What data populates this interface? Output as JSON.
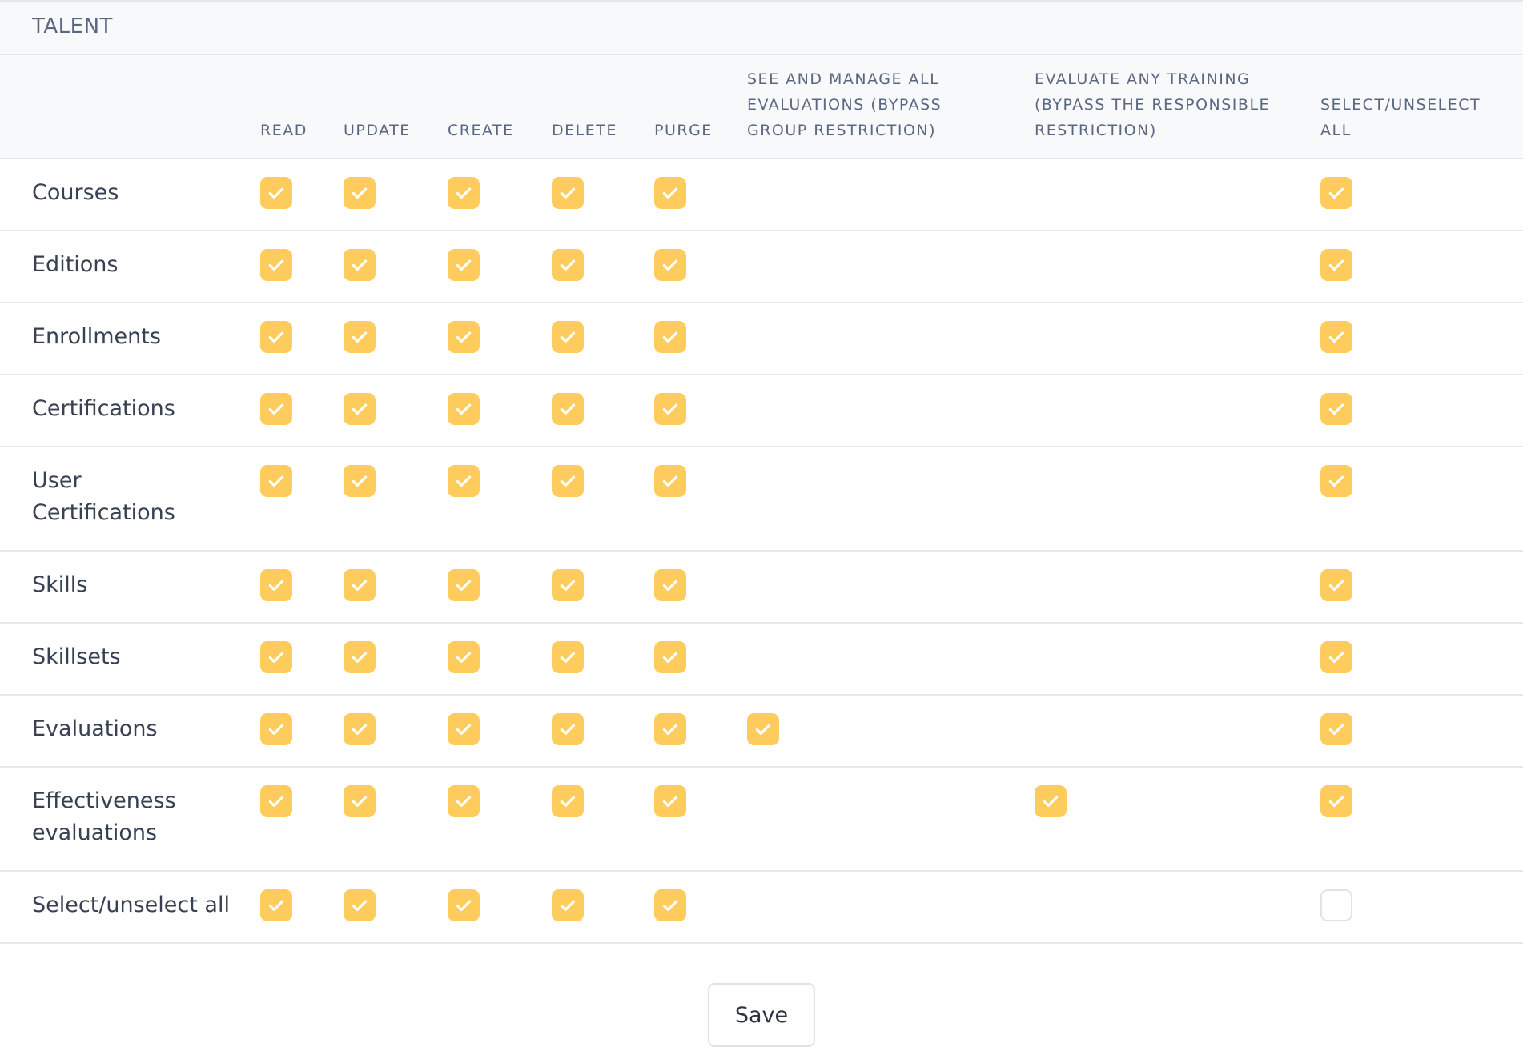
{
  "section": {
    "title": "TALENT"
  },
  "columns": [
    {
      "key": "read",
      "label": "READ"
    },
    {
      "key": "update",
      "label": "UPDATE"
    },
    {
      "key": "create",
      "label": "CREATE"
    },
    {
      "key": "delete",
      "label": "DELETE"
    },
    {
      "key": "purge",
      "label": "PURGE"
    },
    {
      "key": "manage_evaluations",
      "label": "SEE AND MANAGE ALL EVALUATIONS (BYPASS GROUP RESTRICTION)"
    },
    {
      "key": "evaluate_training",
      "label": "EVALUATE ANY TRAINING (BYPASS THE RESPONSIBLE RESTRICTION)"
    },
    {
      "key": "select_all",
      "label": "SELECT/UNSELECT ALL"
    }
  ],
  "rows": [
    {
      "label": "Courses",
      "read": true,
      "update": true,
      "create": true,
      "delete": true,
      "purge": true,
      "select_all": true
    },
    {
      "label": "Editions",
      "read": true,
      "update": true,
      "create": true,
      "delete": true,
      "purge": true,
      "select_all": true
    },
    {
      "label": "Enrollments",
      "read": true,
      "update": true,
      "create": true,
      "delete": true,
      "purge": true,
      "select_all": true
    },
    {
      "label": "Certifications",
      "read": true,
      "update": true,
      "create": true,
      "delete": true,
      "purge": true,
      "select_all": true
    },
    {
      "label": "User Certifications",
      "read": true,
      "update": true,
      "create": true,
      "delete": true,
      "purge": true,
      "select_all": true
    },
    {
      "label": "Skills",
      "read": true,
      "update": true,
      "create": true,
      "delete": true,
      "purge": true,
      "select_all": true
    },
    {
      "label": "Skillsets",
      "read": true,
      "update": true,
      "create": true,
      "delete": true,
      "purge": true,
      "select_all": true
    },
    {
      "label": "Evaluations",
      "read": true,
      "update": true,
      "create": true,
      "delete": true,
      "purge": true,
      "manage_evaluations": true,
      "select_all": true
    },
    {
      "label": "Effectiveness evaluations",
      "read": true,
      "update": true,
      "create": true,
      "delete": true,
      "purge": true,
      "evaluate_training": true,
      "select_all": true
    },
    {
      "label": "Select/unselect all",
      "read": true,
      "update": true,
      "create": true,
      "delete": true,
      "purge": true,
      "select_all": false
    }
  ],
  "actions": {
    "save_label": "Save"
  },
  "colors": {
    "accent": "#fecb5d",
    "header_bg": "#f8f9fb",
    "header_text": "#5a6781"
  }
}
